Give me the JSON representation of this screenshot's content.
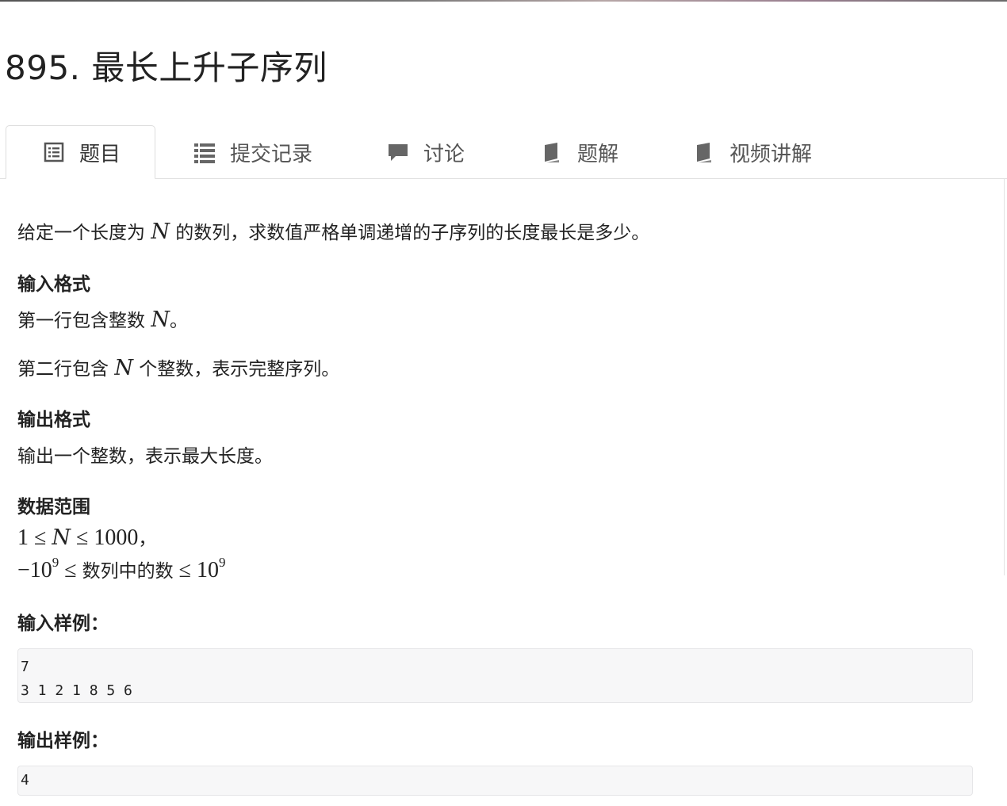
{
  "problem": {
    "title": "895. 最长上升子序列"
  },
  "tabs": [
    {
      "label": "题目",
      "icon": "document-list-icon",
      "active": true
    },
    {
      "label": "提交记录",
      "icon": "list-icon"
    },
    {
      "label": "讨论",
      "icon": "comment-icon"
    },
    {
      "label": "题解",
      "icon": "book-icon"
    },
    {
      "label": "视频讲解",
      "icon": "book-icon"
    }
  ],
  "description": {
    "before": "给定一个长度为 ",
    "var": "N",
    "after": " 的数列，求数值严格单调递增的子序列的长度最长是多少。"
  },
  "input_format": {
    "heading": "输入格式",
    "line1": {
      "before": "第一行包含整数 ",
      "var": "N",
      "after": "。"
    },
    "line2": {
      "before": "第二行包含 ",
      "var": "N",
      "after": " 个整数，表示完整序列。"
    }
  },
  "output_format": {
    "heading": "输出格式",
    "text": "输出一个整数，表示最大长度。"
  },
  "data_range": {
    "heading": "数据范围",
    "row1": {
      "lo": "1",
      "le1": "≤",
      "var": "N",
      "le2": "≤",
      "hi": "1000",
      "tail": "，"
    },
    "row2": {
      "neg": "−10",
      "exp1": "9",
      "le1": "≤",
      "mid": "数列中的数",
      "le2": "≤",
      "hi": "10",
      "exp2": "9"
    }
  },
  "sample_input": {
    "heading": "输入样例：",
    "lines": [
      "7",
      "3 1 2 1 8 5 6"
    ]
  },
  "sample_output": {
    "heading": "输出样例：",
    "lines": [
      "4"
    ]
  },
  "colors": {
    "accent": "#777777",
    "code_bg": "#f7f7f8",
    "border": "#dddddd"
  }
}
